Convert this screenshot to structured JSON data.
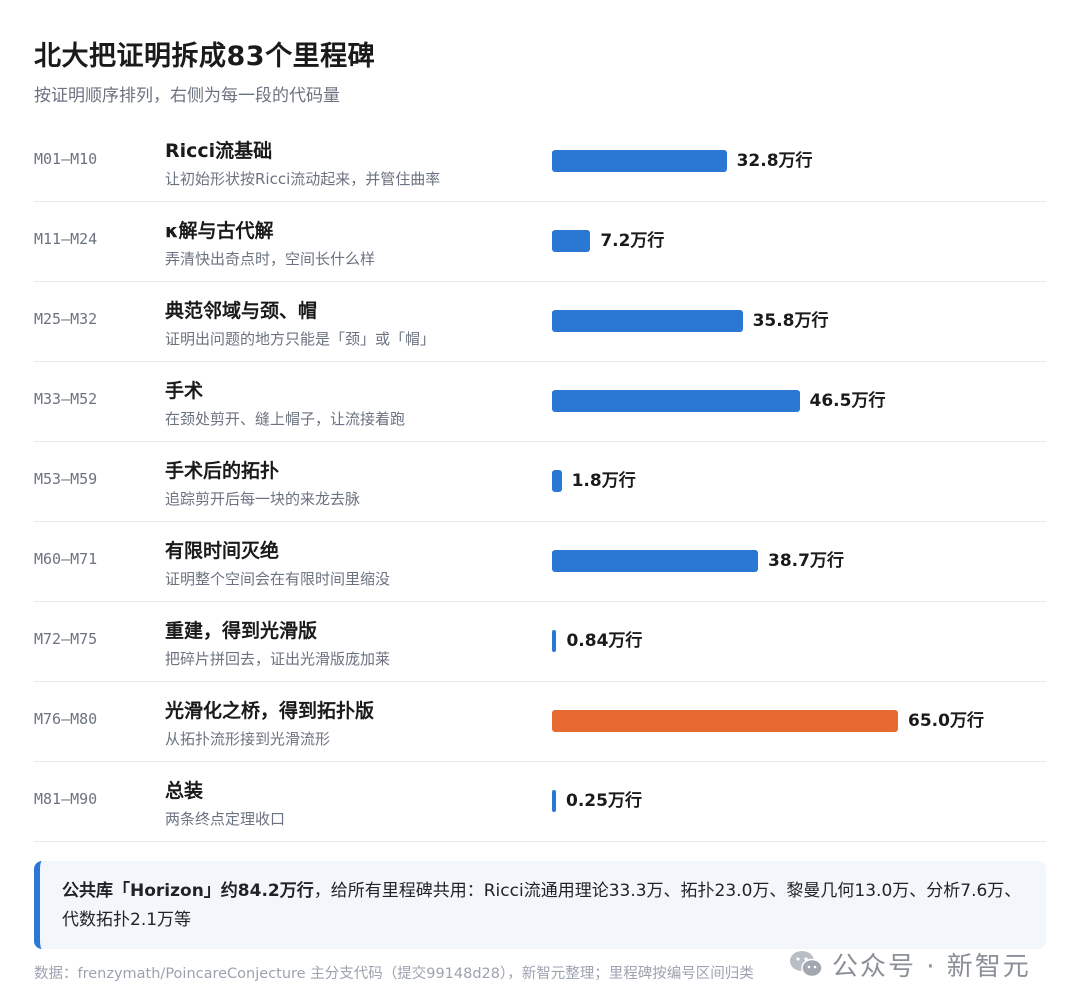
{
  "title": "北大把证明拆成83个里程碑",
  "subtitle": "按证明顺序排列，右侧为每一段的代码量",
  "colors": {
    "bar_default": "#2b78d4",
    "bar_highlight": "#e86a33",
    "note_accent": "#2b78d4"
  },
  "chart_data": {
    "type": "bar",
    "orientation": "horizontal",
    "xlim": [
      0,
      65.0
    ],
    "value_unit": "万行",
    "categories": [
      "M01–M10",
      "M11–M24",
      "M25–M32",
      "M33–M52",
      "M53–M59",
      "M60–M71",
      "M72–M75",
      "M76–M80",
      "M81–M90"
    ],
    "rows": [
      {
        "range": "M01–M10",
        "name": "Ricci流基础",
        "desc": "让初始形状按Ricci流动起来，并管住曲率",
        "value": 32.8,
        "label": "32.8万行",
        "highlight": false
      },
      {
        "range": "M11–M24",
        "name": "κ解与古代解",
        "desc": "弄清快出奇点时，空间长什么样",
        "value": 7.2,
        "label": "7.2万行",
        "highlight": false
      },
      {
        "range": "M25–M32",
        "name": "典范邻域与颈、帽",
        "desc": "证明出问题的地方只能是「颈」或「帽」",
        "value": 35.8,
        "label": "35.8万行",
        "highlight": false
      },
      {
        "range": "M33–M52",
        "name": "手术",
        "desc": "在颈处剪开、缝上帽子，让流接着跑",
        "value": 46.5,
        "label": "46.5万行",
        "highlight": false
      },
      {
        "range": "M53–M59",
        "name": "手术后的拓扑",
        "desc": "追踪剪开后每一块的来龙去脉",
        "value": 1.8,
        "label": "1.8万行",
        "highlight": false
      },
      {
        "range": "M60–M71",
        "name": "有限时间灭绝",
        "desc": "证明整个空间会在有限时间里缩没",
        "value": 38.7,
        "label": "38.7万行",
        "highlight": false
      },
      {
        "range": "M72–M75",
        "name": "重建，得到光滑版",
        "desc": "把碎片拼回去，证出光滑版庞加莱",
        "value": 0.84,
        "label": "0.84万行",
        "highlight": false
      },
      {
        "range": "M76–M80",
        "name": "光滑化之桥，得到拓扑版",
        "desc": "从拓扑流形接到光滑流形",
        "value": 65.0,
        "label": "65.0万行",
        "highlight": true
      },
      {
        "range": "M81–M90",
        "name": "总装",
        "desc": "两条终点定理收口",
        "value": 0.25,
        "label": "0.25万行",
        "highlight": false
      }
    ]
  },
  "note": {
    "bold": "公共库「Horizon」约84.2万行",
    "rest": "，给所有里程碑共用：Ricci流通用理论33.3万、拓扑23.0万、黎曼几何13.0万、分析7.6万、代数拓扑2.1万等"
  },
  "source": "数据：frenzymath/PoincareConjecture 主分支代码（提交99148d28），新智元整理；里程碑按编号区间归类",
  "watermark": {
    "icon": "wechat-icon",
    "text": "公众号 · 新智元"
  }
}
